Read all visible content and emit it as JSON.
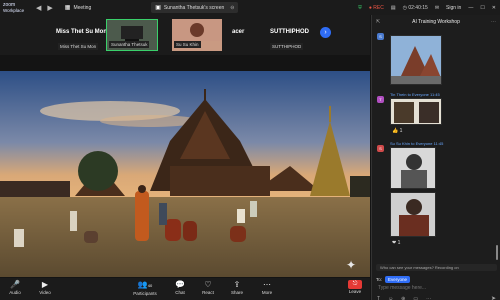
{
  "titlebar": {
    "logo_line1": "zoom",
    "logo_line2": "Workplace",
    "tabs": [
      {
        "label": "Meeting"
      },
      {
        "label": "Sunantha Thetsuk's screen"
      }
    ],
    "rec_label": "REC",
    "time": "02:40:15",
    "signin_label": "Sign in"
  },
  "participants": [
    {
      "name": "Miss Thet Su Mon",
      "sub": "Miss Thet Su Mon"
    },
    {
      "name": "",
      "sub": "Sunantha Thetsuk"
    },
    {
      "name": "",
      "sub": "Su Su Khin"
    },
    {
      "name": "acer",
      "sub": ""
    },
    {
      "name": "SUTTHIPHOD",
      "sub": "SUTTHIPHOD"
    }
  ],
  "toolbar": {
    "items": [
      {
        "label": "Audio",
        "icon": "microphone-icon"
      },
      {
        "label": "Video",
        "icon": "camera-icon"
      },
      {
        "label": "Participants",
        "icon": "people-icon",
        "count": "40"
      },
      {
        "label": "Chat",
        "icon": "chat-icon"
      },
      {
        "label": "React",
        "icon": "heart-icon"
      },
      {
        "label": "Share",
        "icon": "share-icon"
      },
      {
        "label": "More",
        "icon": "more-icon"
      },
      {
        "label": "Leave",
        "icon": "leave-icon"
      }
    ]
  },
  "chat": {
    "title": "AI Training Workshop",
    "messages": [
      {
        "sender": "S",
        "meta": "",
        "reaction": ""
      },
      {
        "sender": "T",
        "meta": "Tin Thein to Everyone  11:45",
        "reaction": "👍 1"
      },
      {
        "sender": "S",
        "meta": "Su Su Khin to Everyone  11:45",
        "reaction": "❤ 1"
      }
    ],
    "note": "Who can see your messages? Recording on",
    "to_label": "To:",
    "to_value": "Everyone",
    "input_placeholder": "Type message here..."
  },
  "colors": {
    "accent": "#2f6df6",
    "rec": "#e54",
    "leave": "#e53935",
    "active_speaker": "#3ad06b"
  }
}
